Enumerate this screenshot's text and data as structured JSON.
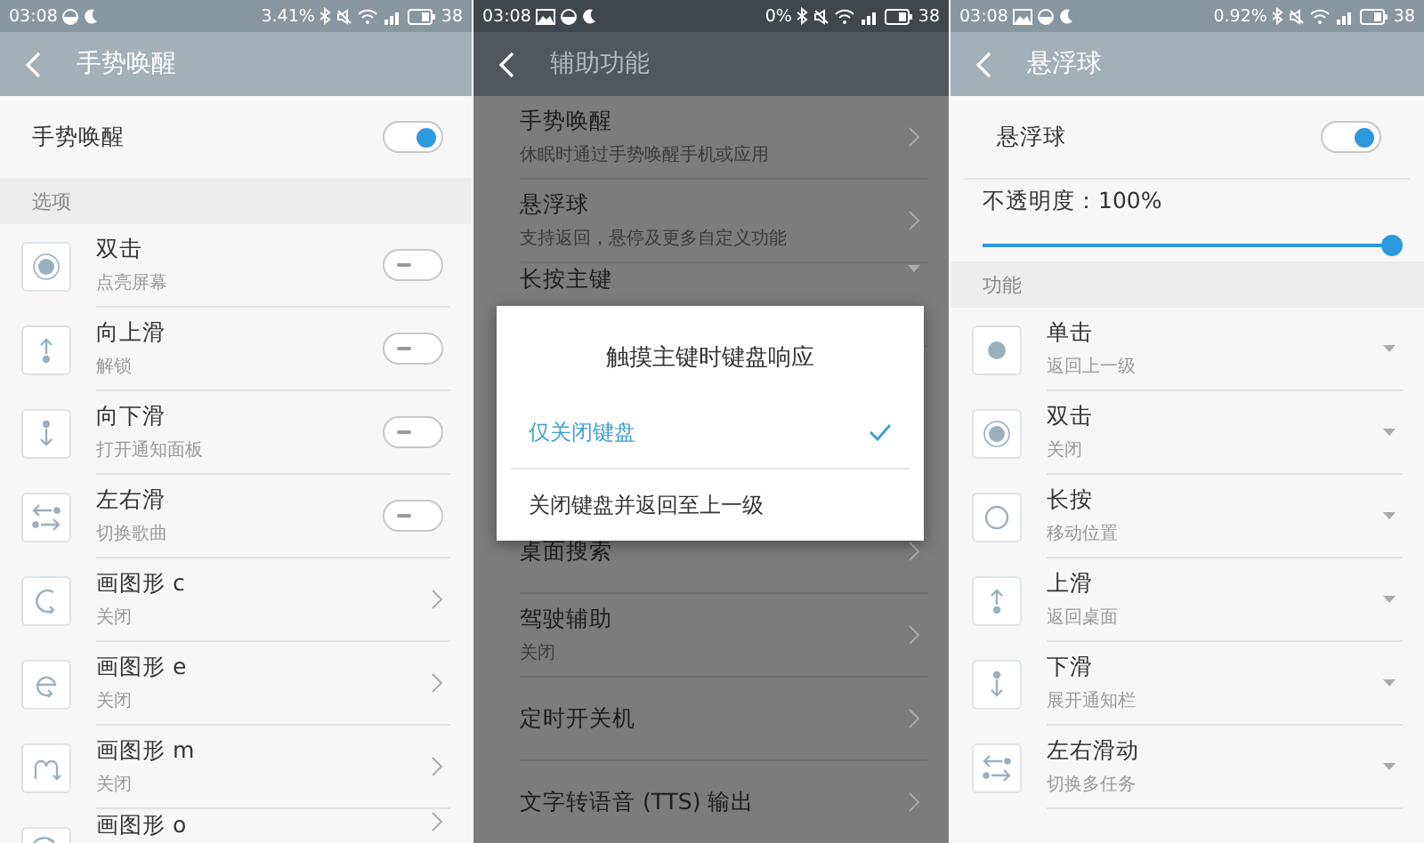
{
  "panels": [
    {
      "status_bar": {
        "time": "03:08",
        "gallery_notification": false,
        "data_rate": "3.41%",
        "battery": "38"
      },
      "header": {
        "title": "手势唤醒"
      },
      "dimmed": false,
      "rows": [
        {
          "kind": "main-switch",
          "title": "手势唤醒",
          "on": true
        },
        {
          "kind": "section",
          "title": "选项"
        },
        {
          "kind": "switch",
          "title": "双击",
          "subtitle": "点亮屏幕",
          "on": false
        },
        {
          "kind": "switch",
          "title": "向上滑",
          "subtitle": "解锁",
          "on": false
        },
        {
          "kind": "switch",
          "title": "向下滑",
          "subtitle": "打开通知面板",
          "on": false
        },
        {
          "kind": "switch",
          "title": "左右滑",
          "subtitle": "切换歌曲",
          "on": false
        },
        {
          "kind": "chevron",
          "title": "画图形 c",
          "subtitle": "关闭"
        },
        {
          "kind": "chevron",
          "title": "画图形 e",
          "subtitle": "关闭"
        },
        {
          "kind": "chevron",
          "title": "画图形 m",
          "subtitle": "关闭"
        },
        {
          "kind": "chevron",
          "title": "画图形 o"
        }
      ]
    },
    {
      "status_bar": {
        "time": "03:08",
        "gallery_notification": true,
        "data_rate": "0%",
        "battery": "38"
      },
      "header": {
        "title": "辅助功能"
      },
      "dimmed": true,
      "rows": [
        {
          "kind": "chevron",
          "title": "手势唤醒",
          "subtitle": "休眠时通过手势唤醒手机或应用"
        },
        {
          "kind": "chevron",
          "title": "悬浮球",
          "subtitle": "支持返回，悬停及更多自定义功能"
        },
        {
          "kind": "dropdown",
          "title": "长按主键"
        }
      ],
      "dialog": {
        "title": "触摸主键时键盘响应",
        "options": [
          {
            "label": "仅关闭键盘",
            "selected": true
          },
          {
            "label": "关闭键盘并返回至上一级",
            "selected": false
          }
        ]
      },
      "rows_below_dialog": [
        {
          "kind": "chevron",
          "title": "桌面搜索"
        },
        {
          "kind": "chevron",
          "title": "驾驶辅助",
          "subtitle": "关闭"
        },
        {
          "kind": "chevron",
          "title": "定时开关机"
        },
        {
          "kind": "chevron",
          "title": "文字转语音 (TTS) 输出"
        }
      ]
    },
    {
      "status_bar": {
        "time": "03:08",
        "gallery_notification": true,
        "data_rate": "0.92%",
        "battery": "38"
      },
      "header": {
        "title": "悬浮球"
      },
      "dimmed": false,
      "rows": [
        {
          "kind": "main-switch",
          "title": "悬浮球",
          "on": true
        },
        {
          "kind": "slider",
          "title": "不透明度：100%",
          "level": 1
        },
        {
          "kind": "section",
          "title": "功能"
        },
        {
          "kind": "dropdown",
          "title": "单击",
          "subtitle": "返回上一级"
        },
        {
          "kind": "dropdown",
          "title": "双击",
          "subtitle": "关闭"
        },
        {
          "kind": "dropdown",
          "title": "长按",
          "subtitle": "移动位置"
        },
        {
          "kind": "dropdown",
          "title": "上滑",
          "subtitle": "返回桌面"
        },
        {
          "kind": "dropdown",
          "title": "下滑",
          "subtitle": "展开通知栏"
        },
        {
          "kind": "dropdown",
          "title": "左右滑动",
          "subtitle": "切换多任务"
        }
      ]
    }
  ]
}
